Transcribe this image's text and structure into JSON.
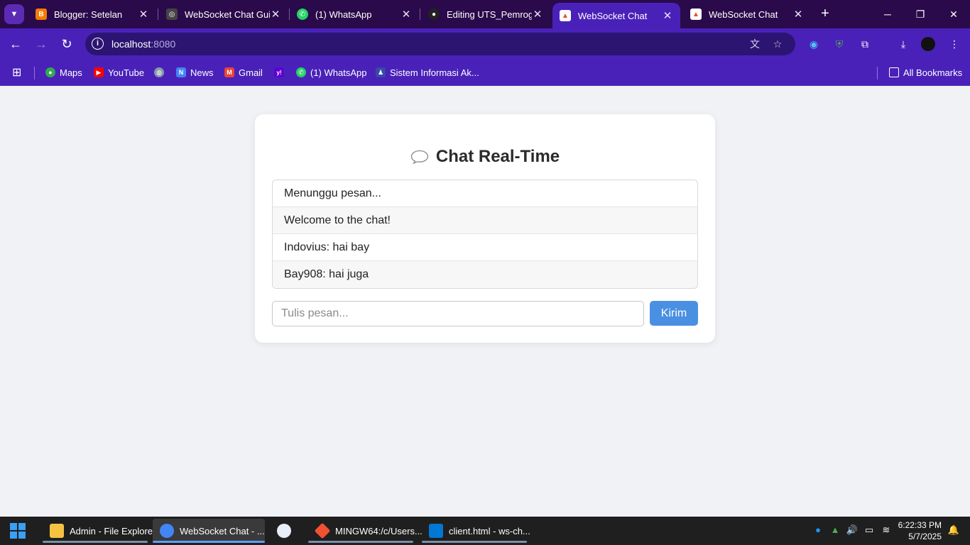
{
  "browser": {
    "tabs": [
      {
        "title": "Blogger: Setelan",
        "favicon_color": "#f57c00",
        "favicon_glyph": "B",
        "active": false
      },
      {
        "title": "WebSocket Chat Guid",
        "favicon_color": "#444444",
        "favicon_glyph": "◎",
        "active": false
      },
      {
        "title": "(1) WhatsApp",
        "favicon_color": "#25d366",
        "favicon_glyph": "✆",
        "active": false
      },
      {
        "title": "Editing UTS_Pemrogr",
        "favicon_color": "#222222",
        "favicon_glyph": "●",
        "active": false
      },
      {
        "title": "WebSocket Chat",
        "favicon_color": "#e44d26",
        "favicon_glyph": "▲",
        "active": true
      },
      {
        "title": "WebSocket Chat",
        "favicon_color": "#e44d26",
        "favicon_glyph": "▲",
        "active": false
      }
    ],
    "address": {
      "host": "localhost",
      "port": ":8080"
    },
    "bookmarks": [
      {
        "label": "Maps",
        "color": "#34a853",
        "glyph": "●"
      },
      {
        "label": "YouTube",
        "color": "#ff0000",
        "glyph": "▶"
      },
      {
        "label": "",
        "color": "#8899aa",
        "glyph": "◍"
      },
      {
        "label": "News",
        "color": "#4285f4",
        "glyph": "N"
      },
      {
        "label": "Gmail",
        "color": "#ea4335",
        "glyph": "M"
      },
      {
        "label": "",
        "color": "#6001d2",
        "glyph": "y!"
      },
      {
        "label": "(1) WhatsApp",
        "color": "#25d366",
        "glyph": "✆"
      },
      {
        "label": "Sistem Informasi Ak...",
        "color": "#3949ab",
        "glyph": "♟"
      }
    ],
    "all_bookmarks_label": "All Bookmarks"
  },
  "chat": {
    "title": "Chat Real-Time",
    "messages": [
      "Menunggu pesan...",
      "Welcome to the chat!",
      "Indovius: hai bay",
      "Bay908: hai juga"
    ],
    "input_placeholder": "Tulis pesan...",
    "send_label": "Kirim"
  },
  "taskbar": {
    "items": [
      {
        "label": "Admin - File Explorer",
        "color": "#f5c242",
        "active": false
      },
      {
        "label": "WebSocket Chat - ...",
        "color": "#4285f4",
        "active": true
      },
      {
        "label": "",
        "color": "#e8eef8",
        "active": false
      },
      {
        "label": "MINGW64:/c/Users...",
        "color": "#f05133",
        "active": false
      },
      {
        "label": "client.html - ws-ch...",
        "color": "#0078d4",
        "active": false
      }
    ],
    "time": "6:22:33 PM",
    "date": "5/7/2025"
  },
  "colors": {
    "tabstrip": "#2a0a4a",
    "toolbar": "#4a21b8",
    "send_button": "#4a90e2",
    "page_background": "#f0f2f5"
  }
}
